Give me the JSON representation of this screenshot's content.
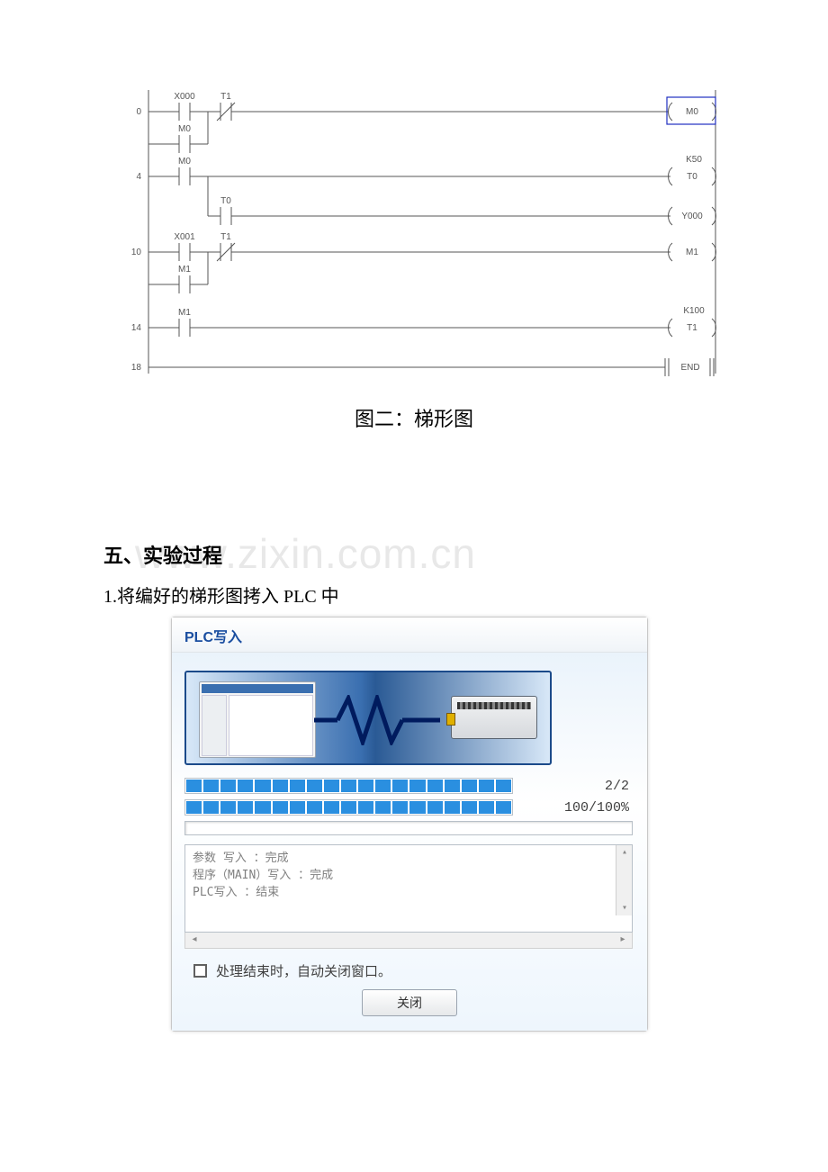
{
  "ladder": {
    "rungs": {
      "r0": "0",
      "r4": "4",
      "r10": "10",
      "r14": "14",
      "r18": "18"
    },
    "contacts": {
      "x000": "X000",
      "t1a": "T1",
      "m0a": "M0",
      "m0b": "M0",
      "t0": "T0",
      "x001": "X001",
      "t1b": "T1",
      "m1a": "M1",
      "m1b": "M1"
    },
    "coils": {
      "m0": "M0",
      "t0": "T0",
      "y000": "Y000",
      "m1": "M1",
      "t1": "T1",
      "end": "END"
    },
    "consts": {
      "k50": "K50",
      "k100": "K100"
    }
  },
  "caption": "图二：梯形图",
  "watermark": "www.zixin.com.cn",
  "section_head": "五、实验过程",
  "body_line1": "1.将编好的梯形图拷入 PLC 中",
  "plc": {
    "title": "PLC写入",
    "progress_count": "2/2",
    "progress_pct": "100/100%",
    "log": {
      "l1": "参数 写入 ：完成",
      "l2": "程序（MAIN）写入 ：完成",
      "l3": "PLC写入 ：结束"
    },
    "checkbox_label": "处理结束时，自动关闭窗口。",
    "close": "关闭"
  }
}
